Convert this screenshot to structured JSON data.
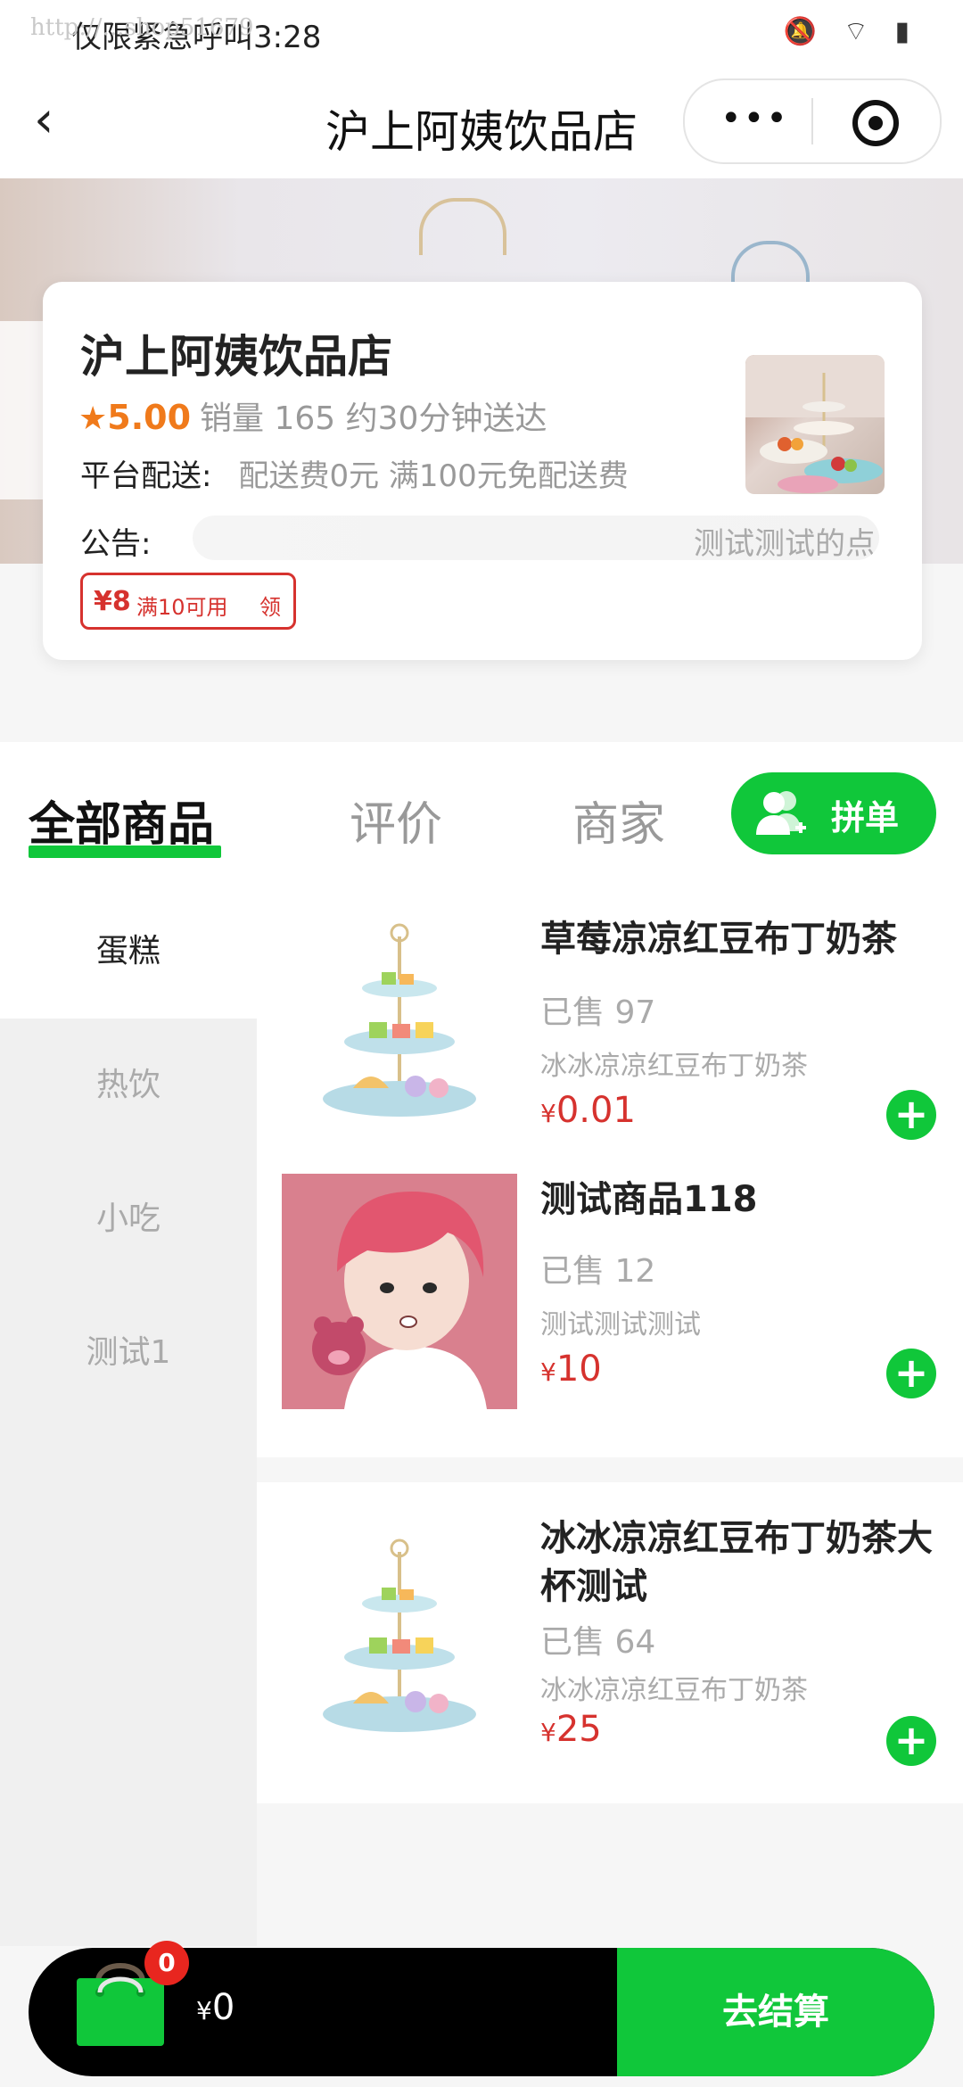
{
  "status_bar": {
    "text": "仅限紧急呼叫3:28",
    "watermark": "http://...shop51679",
    "icons": "🔕 ︎⌔ ▮"
  },
  "nav": {
    "back_label": "‹",
    "title": "沪上阿姨饮品店",
    "more_label": "•••"
  },
  "shop": {
    "name": "沪上阿姨饮品店",
    "star": "★",
    "rating": "5.00",
    "stats": "销量 165 约30分钟送达",
    "delivery_label": "平台配送:",
    "delivery_info": "配送费0元 满100元免配送费",
    "notice_label": "公告:",
    "notice_text": "测试测试的点",
    "coupon": {
      "amount": "¥8",
      "condition": "满10可用",
      "action": "领"
    }
  },
  "tabs": {
    "all": "全部商品",
    "reviews": "评价",
    "merchant": "商家",
    "group_buy": "拼单"
  },
  "categories": [
    "蛋糕",
    "热饮",
    "小吃",
    "测试1"
  ],
  "active_category": "蛋糕",
  "products": [
    {
      "name": "草莓凉凉红豆布丁奶茶",
      "sold": "已售 97",
      "desc": "冰冰凉凉红豆布丁奶茶",
      "currency": "¥",
      "price": "0.01",
      "add": "+"
    },
    {
      "name": "测试商品118",
      "sold": "已售 12",
      "desc": "测试测试测试",
      "currency": "¥",
      "price": "10",
      "add": "+"
    },
    {
      "name": "冰冰凉凉红豆布丁奶茶大杯测试",
      "sold": "已售 64",
      "desc": "冰冰凉凉红豆布丁奶茶",
      "currency": "¥",
      "price": "25",
      "add": "+"
    }
  ],
  "cart": {
    "badge": "0",
    "currency": "¥",
    "total": "0",
    "checkout": "去结算"
  },
  "colors": {
    "accent": "#10c73a",
    "price": "#d6322e",
    "rating": "#f07a1b",
    "badge": "#e8261f"
  }
}
